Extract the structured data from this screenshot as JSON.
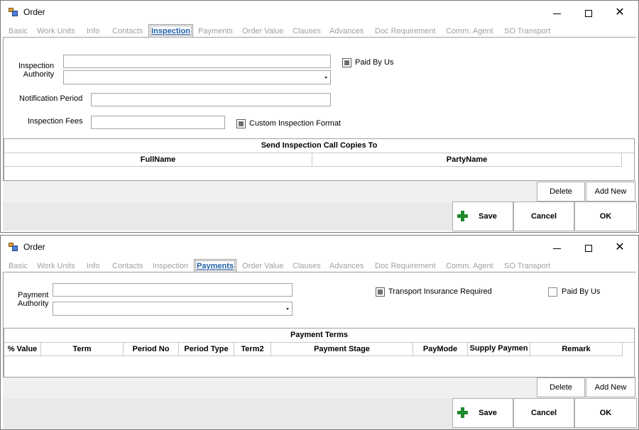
{
  "window1": {
    "title": "Order",
    "tabs": [
      "Basic",
      "Work Units",
      "Info",
      "Contacts",
      "Inspection",
      "Payments",
      "Order Value",
      "Clauses",
      "Advances",
      "Doc Requirement",
      "Comm. Agent",
      "SO Transport"
    ],
    "active_tab": "Inspection",
    "form": {
      "inspection_authority_label": "Inspection\nAuthority",
      "inspection_authority_value": "",
      "inspection_authority_combo": "",
      "paid_by_us_label": "Paid By Us",
      "notification_period_label": "Notification Period",
      "notification_period_value": "",
      "inspection_fees_label": "Inspection Fees",
      "inspection_fees_value": "",
      "custom_format_label": "Custom Inspection Format"
    },
    "grid": {
      "caption": "Send Inspection Call Copies To",
      "columns": [
        "FullName",
        "PartyName"
      ]
    },
    "buttons": {
      "delete": "Delete",
      "add_new": "Add New",
      "save": "Save",
      "cancel": "Cancel",
      "ok": "OK"
    }
  },
  "window2": {
    "title": "Order",
    "tabs": [
      "Basic",
      "Work Units",
      "Info",
      "Contacts",
      "Inspection",
      "Payments",
      "Order Value",
      "Clauses",
      "Advances",
      "Doc Requirement",
      "Comm. Agent",
      "SO Transport"
    ],
    "active_tab": "Payments",
    "form": {
      "payment_authority_label": "Payment\nAuthority",
      "payment_authority_value": "",
      "payment_authority_combo": "",
      "transport_insurance_label": "Transport Insurance Required",
      "paid_by_us_label": "Paid By Us"
    },
    "grid": {
      "caption": "Payment Terms",
      "columns": [
        "% Value",
        "Term",
        "Period No",
        "Period Type",
        "Term2",
        "Payment Stage",
        "PayMode",
        "Supply Paymen",
        "Remark"
      ]
    },
    "buttons": {
      "delete": "Delete",
      "add_new": "Add New",
      "save": "Save",
      "cancel": "Cancel",
      "ok": "OK"
    }
  },
  "colors": {
    "active_tab": "#1f5fa8",
    "inactive_tab": "#a0a0a0",
    "save_icon": "#1f8a2c"
  },
  "icons": {
    "app": "order-app-icon",
    "save": "plus-icon"
  }
}
